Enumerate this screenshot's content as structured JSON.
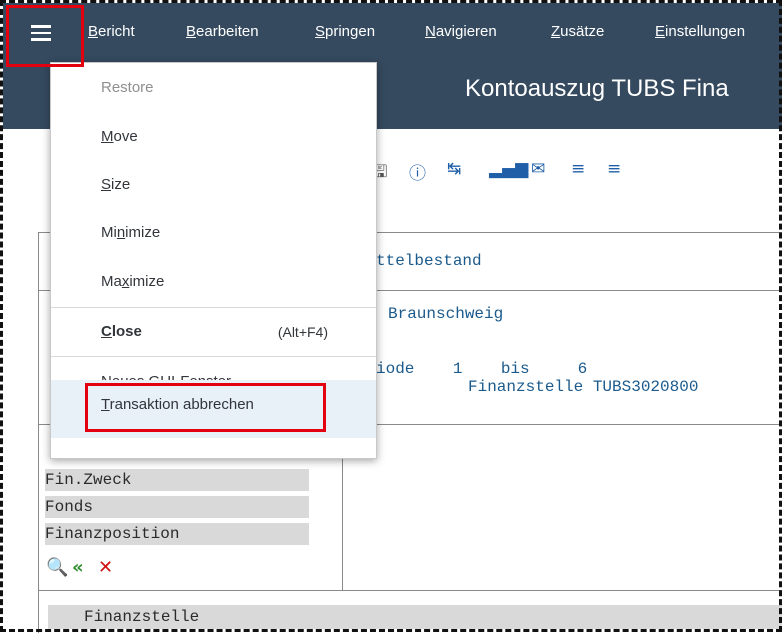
{
  "menubar": {
    "items": [
      {
        "text": "Bericht",
        "ul": "B"
      },
      {
        "text": "Bearbeiten",
        "ul": "B"
      },
      {
        "text": "Springen",
        "ul": "S"
      },
      {
        "text": "Navigieren",
        "ul": "N"
      },
      {
        "text": "Zusätze",
        "ul": "Z"
      },
      {
        "text": "Einstellungen",
        "ul": "E"
      }
    ]
  },
  "title": "Kontoauszug TUBS Fina",
  "toolbar": {
    "icons": [
      "save-icon",
      "info-icon",
      "export-icon",
      "chart-icon",
      "mail-icon",
      "align-center-icon",
      "filter-icon"
    ]
  },
  "dropdown": {
    "restore": "Restore",
    "move": "Move",
    "size": "Size",
    "minimize": "Minimize",
    "maximize": "Maximize",
    "close": "Close",
    "close_shortcut": "(Alt+F4)",
    "new_window": "Neues GUI-Fenster",
    "abort": "Transaktion abbrechen"
  },
  "report": {
    "line1": "ttelbestand",
    "line2": "Braunschweig",
    "line3": "iode    1    bis     6",
    "line4": "Finanzstelle TUBS3020800",
    "fields": [
      "Fin.Zweck",
      "Fonds",
      "Finanzposition"
    ],
    "bottom_field": "Finanzstelle"
  },
  "colors": {
    "menubar_bg": "#354a5f",
    "highlight_red": "#e3000f",
    "report_text": "#1b5a8c"
  }
}
